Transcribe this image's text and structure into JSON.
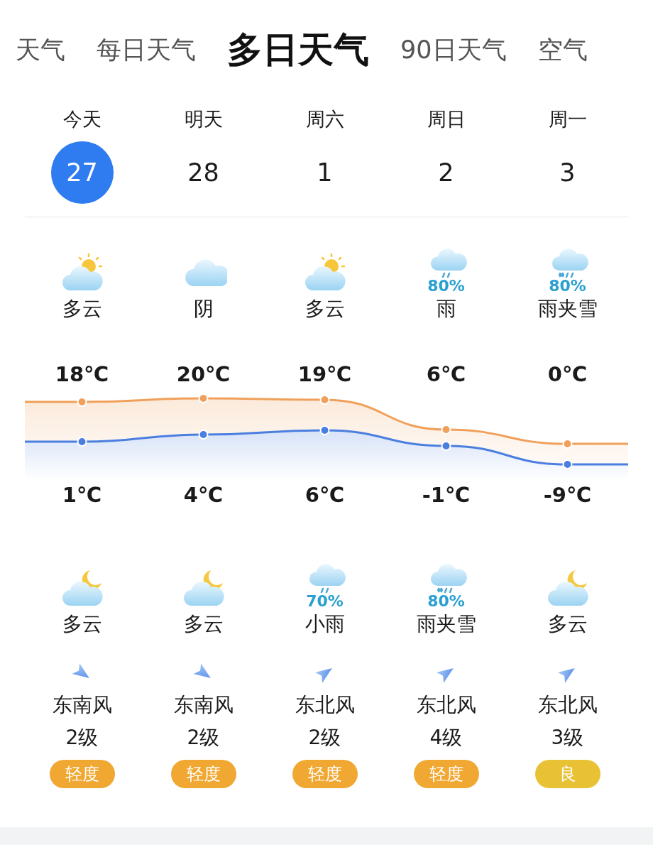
{
  "tabs": [
    {
      "label": "天气",
      "selected": false
    },
    {
      "label": "每日天气",
      "selected": false
    },
    {
      "label": "多日天气",
      "selected": true
    },
    {
      "label": "90日天气",
      "selected": false
    },
    {
      "label": "空气",
      "selected": false
    }
  ],
  "days": [
    {
      "weekday": "今天",
      "date": "27",
      "today": true,
      "day": {
        "kind": "sun_cloud",
        "condition": "多云"
      },
      "high": "18℃",
      "low": "1℃",
      "night": {
        "kind": "moon_cloud",
        "condition": "多云"
      },
      "wind": {
        "kind": "se",
        "direction": "东南风",
        "level": "2级"
      },
      "aqi": {
        "label": "轻度",
        "color": "#f0a832"
      }
    },
    {
      "weekday": "明天",
      "date": "28",
      "today": false,
      "day": {
        "kind": "cloud",
        "condition": "阴"
      },
      "high": "20℃",
      "low": "4℃",
      "night": {
        "kind": "moon_cloud",
        "condition": "多云"
      },
      "wind": {
        "kind": "se",
        "direction": "东南风",
        "level": "2级"
      },
      "aqi": {
        "label": "轻度",
        "color": "#f0a832"
      }
    },
    {
      "weekday": "周六",
      "date": "1",
      "today": false,
      "day": {
        "kind": "sun_cloud",
        "condition": "多云"
      },
      "high": "19℃",
      "low": "6℃",
      "night": {
        "kind": "rain",
        "precip": "70%",
        "condition": "小雨"
      },
      "wind": {
        "kind": "ne",
        "direction": "东北风",
        "level": "2级"
      },
      "aqi": {
        "label": "轻度",
        "color": "#f0a832"
      }
    },
    {
      "weekday": "周日",
      "date": "2",
      "today": false,
      "day": {
        "kind": "rain",
        "precip": "80%",
        "condition": "雨"
      },
      "high": "6℃",
      "low": "-1℃",
      "night": {
        "kind": "sleet",
        "precip": "80%",
        "condition": "雨夹雪"
      },
      "wind": {
        "kind": "ne",
        "direction": "东北风",
        "level": "4级"
      },
      "aqi": {
        "label": "轻度",
        "color": "#f0a832"
      }
    },
    {
      "weekday": "周一",
      "date": "3",
      "today": false,
      "day": {
        "kind": "sleet",
        "precip": "80%",
        "condition": "雨夹雪"
      },
      "high": "0℃",
      "low": "-9℃",
      "night": {
        "kind": "moon_cloud",
        "condition": "多云"
      },
      "wind": {
        "kind": "ne",
        "direction": "东北风",
        "level": "3级"
      },
      "aqi": {
        "label": "良",
        "color": "#e8c234"
      }
    }
  ]
}
